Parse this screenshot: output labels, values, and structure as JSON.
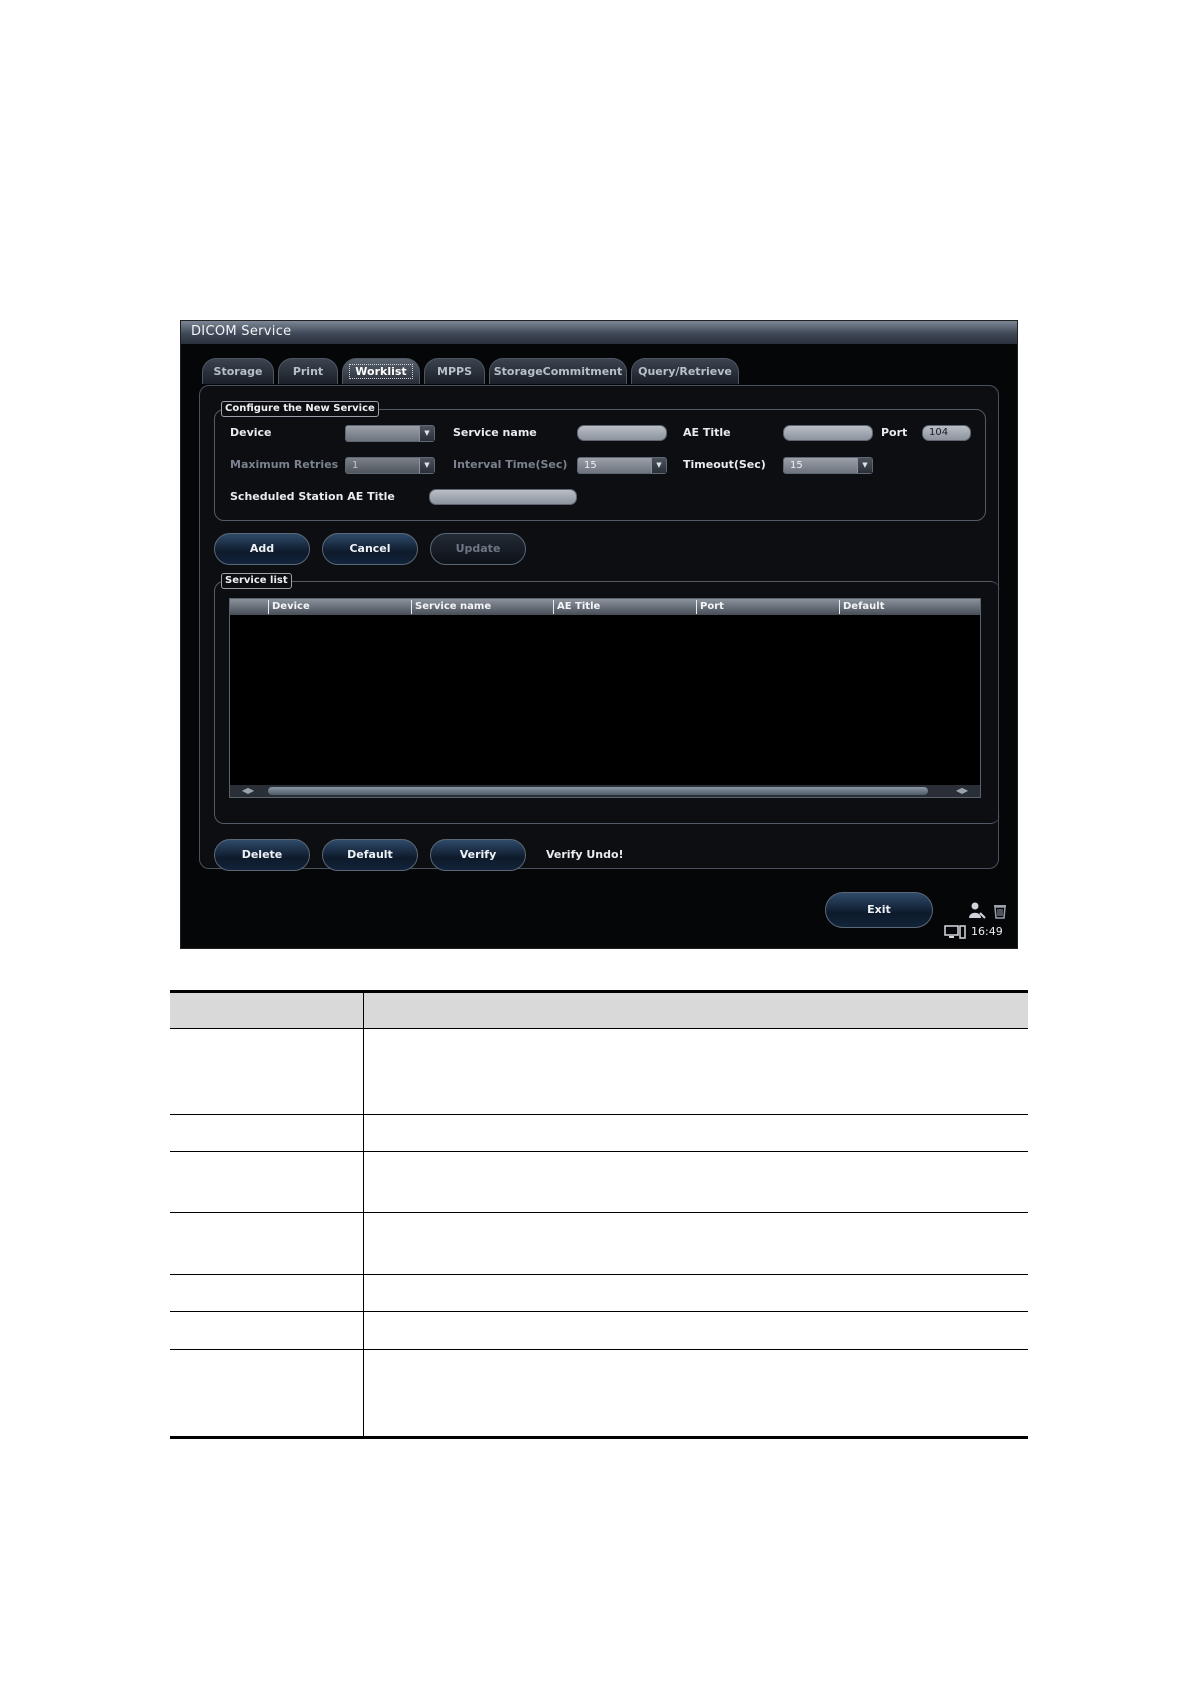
{
  "window": {
    "title": "DICOM Service"
  },
  "tabs": [
    {
      "label": "Storage",
      "active": false
    },
    {
      "label": "Print",
      "active": false
    },
    {
      "label": "Worklist",
      "active": true
    },
    {
      "label": "MPPS",
      "active": false
    },
    {
      "label": "StorageCommitment",
      "active": false
    },
    {
      "label": "Query/Retrieve",
      "active": false
    }
  ],
  "configure": {
    "legend": "Configure the New Service",
    "device_label": "Device",
    "device_value": "",
    "service_name_label": "Service name",
    "service_name_value": "",
    "ae_title_label": "AE Title",
    "ae_title_value": "",
    "port_label": "Port",
    "port_value": "104",
    "max_retries_label": "Maximum Retries",
    "max_retries_value": "1",
    "interval_label": "Interval Time(Sec)",
    "interval_value": "15",
    "timeout_label": "Timeout(Sec)",
    "timeout_value": "15",
    "scheduled_label": "Scheduled Station AE Title",
    "scheduled_value": ""
  },
  "actions": {
    "add": "Add",
    "cancel": "Cancel",
    "update": "Update"
  },
  "service_list": {
    "legend": "Service list",
    "columns": [
      "Device",
      "Service name",
      "AE Title",
      "Port",
      "Default"
    ],
    "rows": []
  },
  "bottom": {
    "delete": "Delete",
    "default": "Default",
    "verify": "Verify",
    "status": "Verify Undo!"
  },
  "footer": {
    "exit": "Exit",
    "time": "16:49"
  },
  "icons": {
    "user": "user-icon",
    "trash": "trash-icon",
    "monitor": "monitor-icon",
    "arrows": "scroll-arrow-icon"
  }
}
